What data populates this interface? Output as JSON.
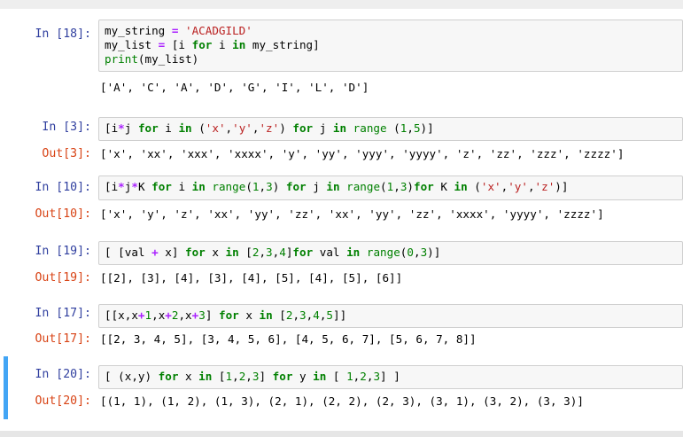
{
  "cells": [
    {
      "in_prompt": "In [18]:",
      "out_prompt": "",
      "code_lines": [
        "my_string = 'ACADGILD'",
        "my_list = [i for i in my_string]",
        "print(my_list)"
      ],
      "output": "['A', 'C', 'A', 'D', 'G', 'I', 'L', 'D']"
    },
    {
      "in_prompt": "In [3]:",
      "out_prompt": "Out[3]:",
      "code_lines": [
        "[i*j for i in ('x','y','z') for j in range (1,5)]"
      ],
      "output": "['x', 'xx', 'xxx', 'xxxx', 'y', 'yy', 'yyy', 'yyyy', 'z', 'zz', 'zzz', 'zzzz']"
    },
    {
      "in_prompt": "In [10]:",
      "out_prompt": "Out[10]:",
      "code_lines": [
        "[i*j*K for i in range(1,3) for j in range(1,3)for K in ('x','y','z')]"
      ],
      "output": "['x', 'y', 'z', 'xx', 'yy', 'zz', 'xx', 'yy', 'zz', 'xxxx', 'yyyy', 'zzzz']"
    },
    {
      "in_prompt": "In [19]:",
      "out_prompt": "Out[19]:",
      "code_lines": [
        "[ [val + x] for x in [2,3,4]for val in range(0,3)]"
      ],
      "output": "[[2], [3], [4], [3], [4], [5], [4], [5], [6]]"
    },
    {
      "in_prompt": "In [17]:",
      "out_prompt": "Out[17]:",
      "code_lines": [
        "[[x,x+1,x+2,x+3] for x in [2,3,4,5]]"
      ],
      "output": "[[2, 3, 4, 5], [3, 4, 5, 6], [4, 5, 6, 7], [5, 6, 7, 8]]"
    },
    {
      "in_prompt": "In [20]:",
      "out_prompt": "Out[20]:",
      "code_lines": [
        "[ (x,y) for x in [1,2,3] for y in [ 1,2,3] ]"
      ],
      "output": "[(1, 1), (1, 2), (1, 3), (2, 1), (2, 2), (2, 3), (3, 1), (3, 2), (3, 3)]"
    }
  ],
  "selected_cell": "In [20]:",
  "colors": {
    "in_prompt": "#303f9f",
    "out_prompt": "#d84315",
    "keyword": "#008000",
    "string": "#ba2121",
    "operator": "#aa22ff",
    "selection_bar": "#42a5f5",
    "input_bg": "#f7f7f7"
  }
}
